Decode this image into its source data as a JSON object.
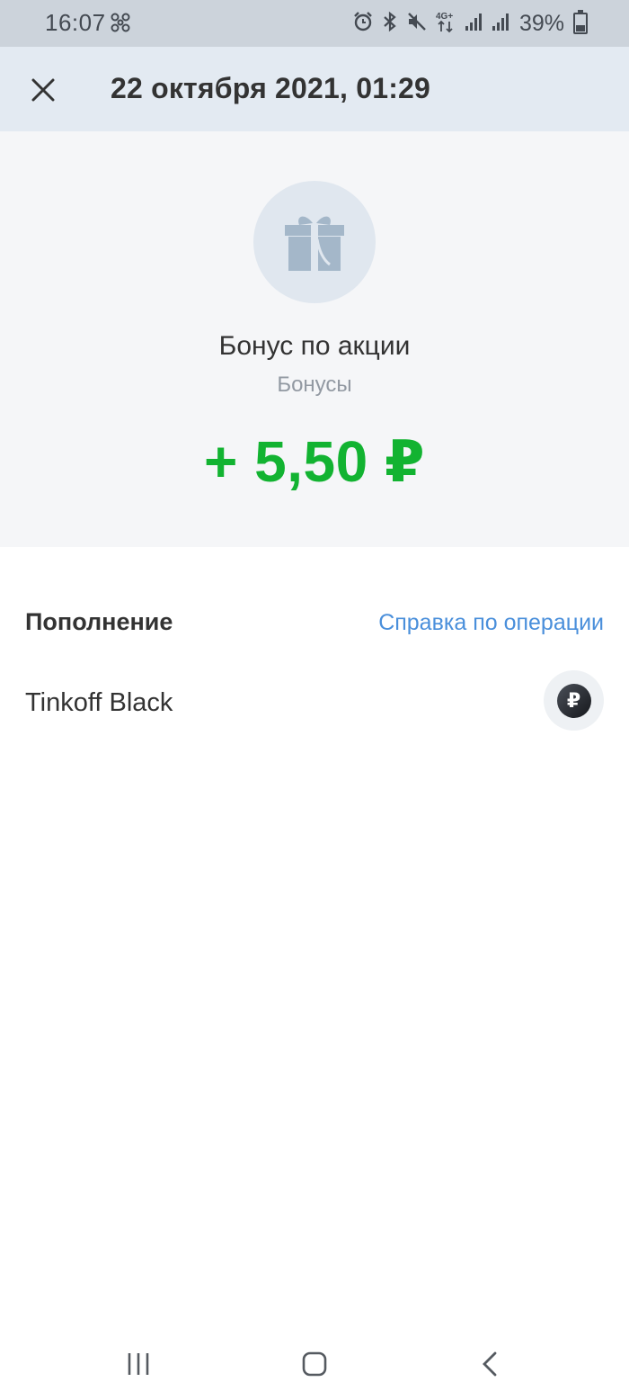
{
  "status_bar": {
    "time": "16:07",
    "battery": "39%",
    "icons": [
      "fan-icon",
      "alarm-icon",
      "bluetooth-icon",
      "mute-icon",
      "4g-icon",
      "signal-icon",
      "signal-icon",
      "battery-icon"
    ]
  },
  "header": {
    "title": "22 октября 2021, 01:29",
    "close_icon": "close-icon"
  },
  "operation": {
    "icon": "gift-icon",
    "title": "Бонус по акции",
    "category": "Бонусы",
    "amount": "+ 5,50 ₽",
    "amount_color": "#12b331"
  },
  "details": {
    "type_label": "Пополнение",
    "help_link": "Справка по операции",
    "account_name": "Tinkoff Black",
    "account_icon": "ruble-icon",
    "account_icon_glyph": "₽"
  },
  "nav_bar": {
    "buttons": [
      "recent-apps-icon",
      "home-icon",
      "back-icon"
    ]
  },
  "colors": {
    "status_bar_bg": "#ccd3db",
    "header_bg": "#e3eaf2",
    "summary_bg": "#f5f6f8",
    "link": "#4a8fdb"
  }
}
